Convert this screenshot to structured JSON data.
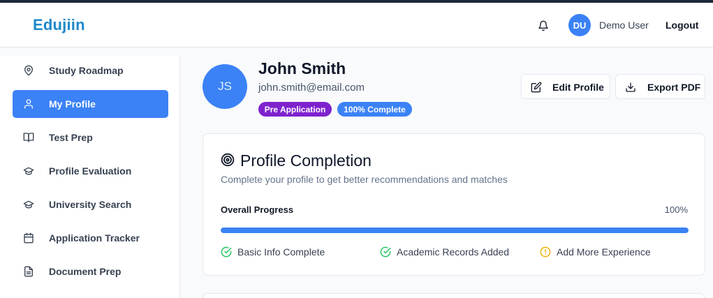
{
  "app": {
    "brand": "Edujiin"
  },
  "header": {
    "avatar_initials": "DU",
    "username": "Demo User",
    "logout_label": "Logout"
  },
  "sidebar": {
    "items": [
      {
        "label": "Study Roadmap",
        "icon": "map-pin-icon",
        "active": false
      },
      {
        "label": "My Profile",
        "icon": "user-icon",
        "active": true
      },
      {
        "label": "Test Prep",
        "icon": "book-open-icon",
        "active": false
      },
      {
        "label": "Profile Evaluation",
        "icon": "graduation-cap-icon",
        "active": false
      },
      {
        "label": "University Search",
        "icon": "graduation-cap-icon",
        "active": false
      },
      {
        "label": "Application Tracker",
        "icon": "calendar-icon",
        "active": false
      },
      {
        "label": "Document Prep",
        "icon": "file-text-icon",
        "active": false
      }
    ]
  },
  "profile": {
    "initials": "JS",
    "name": "John Smith",
    "email": "john.smith@email.com",
    "badges": [
      "Pre Application",
      "100% Complete"
    ],
    "actions": {
      "edit_label": "Edit Profile",
      "export_label": "Export PDF"
    }
  },
  "completion": {
    "title": "Profile Completion",
    "subtitle": "Complete your profile to get better recommendations and matches",
    "progress_label": "Overall Progress",
    "progress_text": "100%",
    "progress_value": 100,
    "checklist": [
      {
        "label": "Basic Info Complete",
        "status": "complete"
      },
      {
        "label": "Academic Records Added",
        "status": "complete"
      },
      {
        "label": "Add More Experience",
        "status": "warning"
      }
    ]
  },
  "colors": {
    "brand": "#1e88c9",
    "accent": "#3b82f6",
    "purple": "#7e22ce",
    "success": "#22c55e",
    "warning": "#eab308"
  }
}
